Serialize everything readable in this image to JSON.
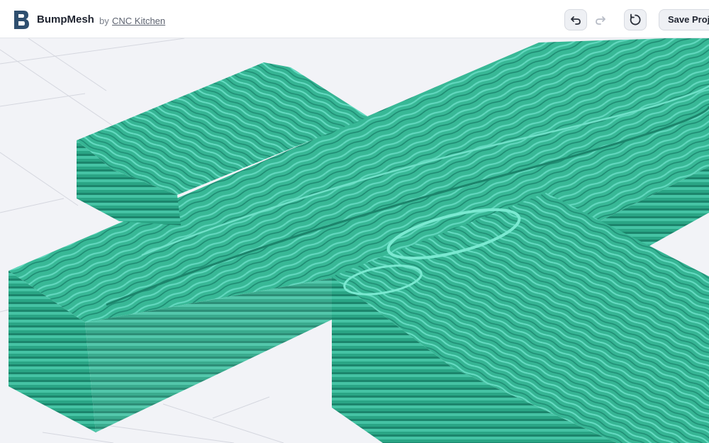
{
  "app": {
    "name": "BumpMesh",
    "by": "by",
    "author": "CNC Kitchen"
  },
  "toolbar": {
    "undo_icon": "undo-icon",
    "redo_icon": "redo-icon",
    "reset_icon": "reset-icon",
    "save_label": "Save Proje"
  },
  "colors": {
    "accent": "#3fbfa0",
    "mesh_dark": "#1f8f77",
    "mesh_light": "#6fe0c8",
    "grid": "#d5d7df",
    "background": "#f2f3f7"
  }
}
